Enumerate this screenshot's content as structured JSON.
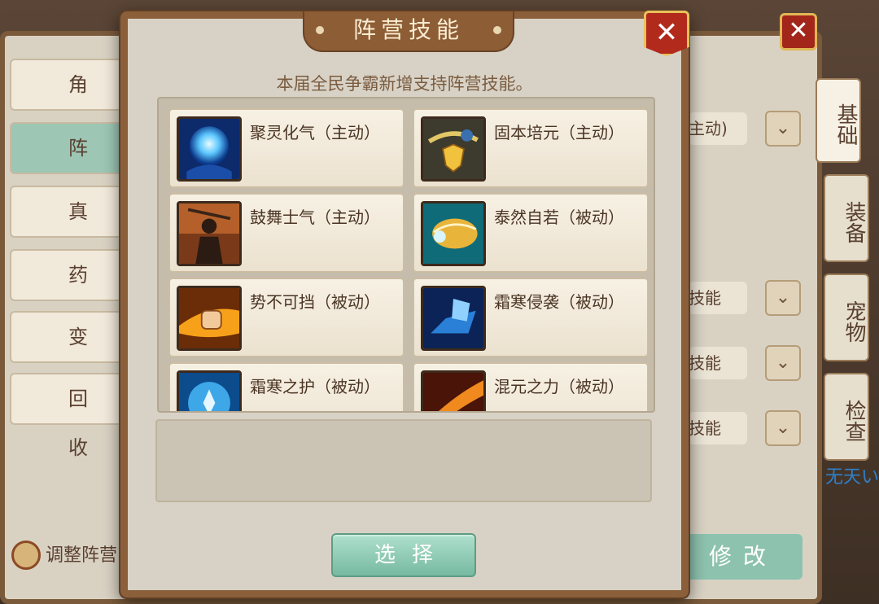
{
  "background": {
    "left_nav": [
      "角　色",
      "阵　营",
      "真　灵",
      "药　品",
      "变　身",
      "回　收"
    ],
    "right_tabs": [
      "基础",
      "装备",
      "宠物",
      "检查"
    ],
    "select_values": [
      "主动)",
      "技能",
      "技能",
      "技能"
    ],
    "adjust_label": "调整阵营",
    "modify_label": "修改",
    "partial_text": "无天い"
  },
  "modal": {
    "title": "阵营技能",
    "close_label": "✕",
    "description": "本届全民争霸新增支持阵营技能。",
    "skills": [
      {
        "name": "聚灵化气（主动）",
        "icon": "blue-orb-hand-icon"
      },
      {
        "name": "固本培元（主动）",
        "icon": "golden-shield-icon"
      },
      {
        "name": "鼓舞士气（主动）",
        "icon": "warrior-rally-icon"
      },
      {
        "name": "泰然自若（被动）",
        "icon": "golden-wing-icon"
      },
      {
        "name": "势不可挡（被动）",
        "icon": "fire-fist-icon"
      },
      {
        "name": "霜寒侵袭（被动）",
        "icon": "frost-boot-icon"
      },
      {
        "name": "霜寒之护（被动）",
        "icon": "frost-lotus-shield-icon"
      },
      {
        "name": "混元之力（被动）",
        "icon": "flame-slash-icon"
      }
    ],
    "select_button": "选择"
  },
  "colors": {
    "modal_border": "#8a5f3a",
    "button_green": "#8cc2ae",
    "close_red": "#b22a1c"
  }
}
